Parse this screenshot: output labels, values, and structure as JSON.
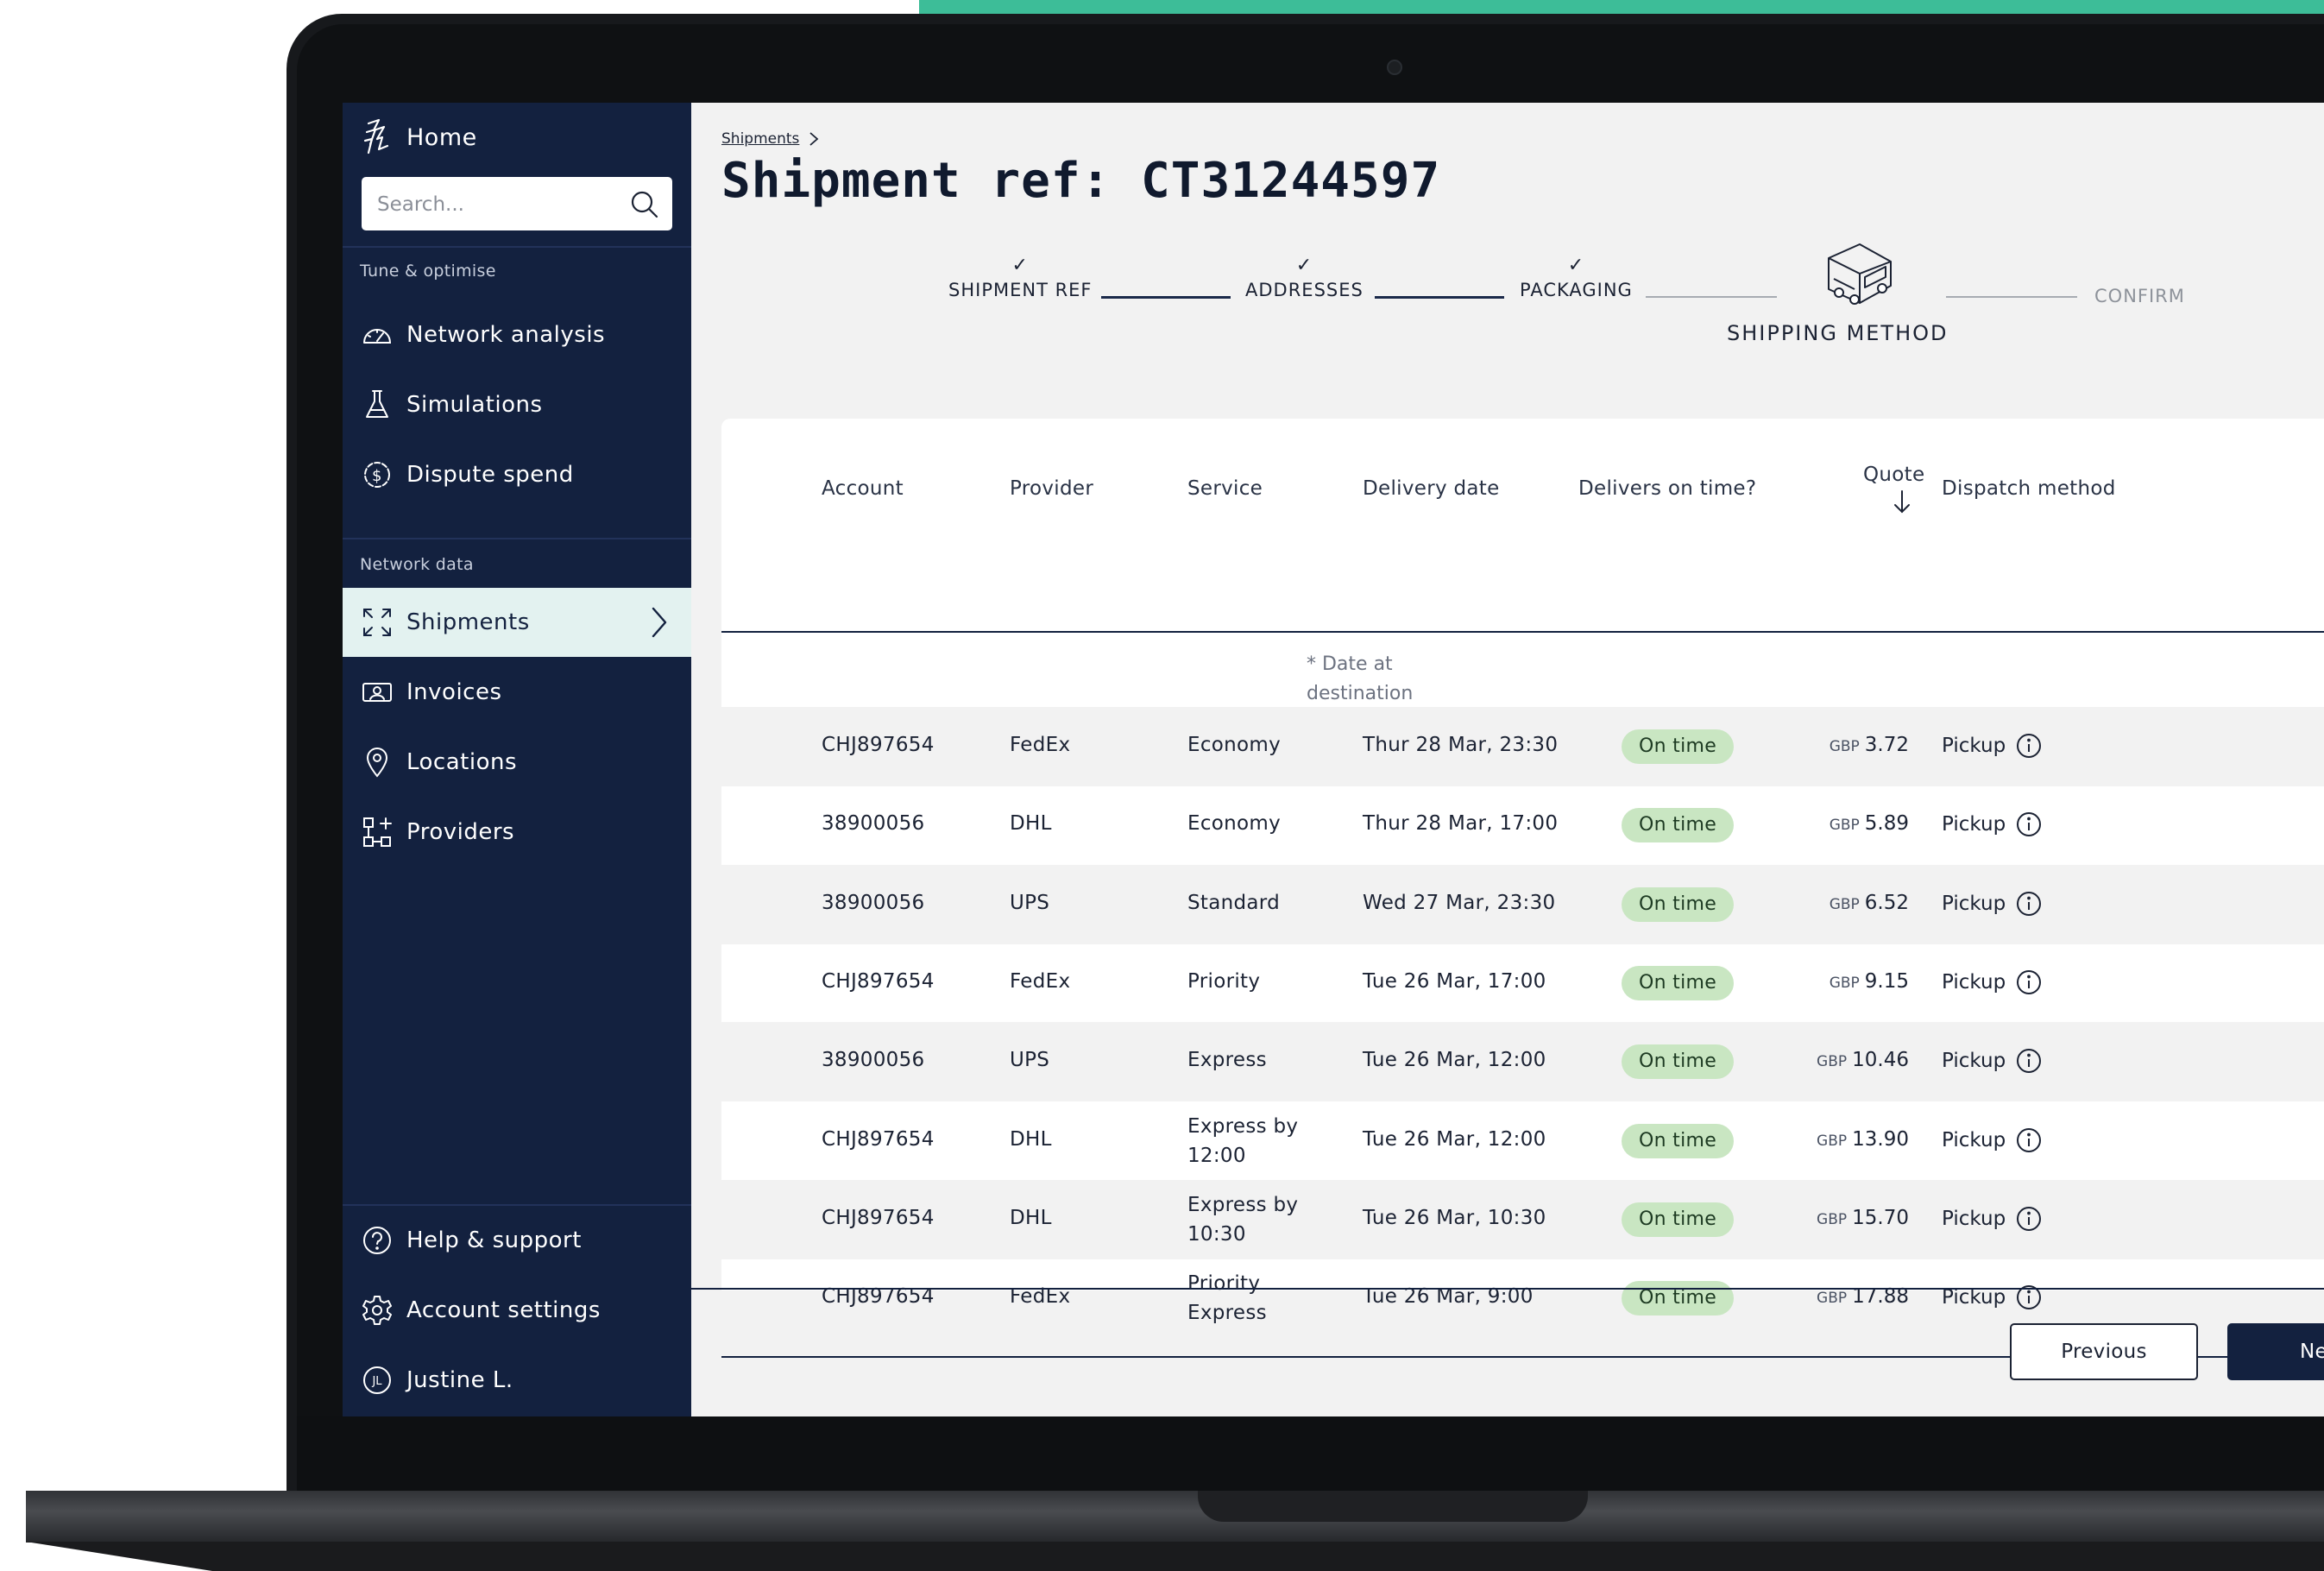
{
  "sidebar": {
    "home_label": "Home",
    "search_placeholder": "Search...",
    "section_tune": "Tune & optimise",
    "section_network": "Network data",
    "items_tune": [
      {
        "label": "Network analysis",
        "icon": "gauge-icon"
      },
      {
        "label": "Simulations",
        "icon": "flask-icon"
      },
      {
        "label": "Dispute spend",
        "icon": "dollar-shield-icon"
      }
    ],
    "items_network": [
      {
        "label": "Shipments",
        "icon": "expand-icon",
        "active": true
      },
      {
        "label": "Invoices",
        "icon": "invoice-icon"
      },
      {
        "label": "Locations",
        "icon": "location-pin-icon"
      },
      {
        "label": "Providers",
        "icon": "providers-icon"
      }
    ],
    "bottom": {
      "help": "Help & support",
      "settings": "Account settings",
      "user_name": "Justine L.",
      "user_initials": "JL"
    }
  },
  "breadcrumb": {
    "parent": "Shipments"
  },
  "page": {
    "title": "Shipment ref: CT31244597"
  },
  "stepper": {
    "steps": [
      "SHIPMENT REF",
      "ADDRESSES",
      "PACKAGING",
      "SHIPPING METHOD",
      "CONFIRM"
    ],
    "completed_marker": "✓",
    "current_index": 3
  },
  "table": {
    "headers": {
      "account": "Account",
      "provider": "Provider",
      "service": "Service",
      "delivery_date": "Delivery date",
      "on_time": "Delivers on time?",
      "quote": "Quote",
      "dispatch": "Dispatch method"
    },
    "note_line1": "* Date at",
    "note_line2": "destination",
    "currency": "GBP",
    "rows": [
      {
        "account": "CHJ897654",
        "provider": "FedEx",
        "service1": "Economy",
        "service2": "",
        "date": "Thur 28 Mar, 23:30",
        "status": "On time",
        "quote": "3.72",
        "dispatch": "Pickup"
      },
      {
        "account": "38900056",
        "provider": "DHL",
        "service1": "Economy",
        "service2": "",
        "date": "Thur 28 Mar, 17:00",
        "status": "On time",
        "quote": "5.89",
        "dispatch": "Pickup"
      },
      {
        "account": "38900056",
        "provider": "UPS",
        "service1": "Standard",
        "service2": "",
        "date": "Wed 27 Mar, 23:30",
        "status": "On time",
        "quote": "6.52",
        "dispatch": "Pickup"
      },
      {
        "account": "CHJ897654",
        "provider": "FedEx",
        "service1": "Priority",
        "service2": "",
        "date": "Tue 26 Mar, 17:00",
        "status": "On time",
        "quote": "9.15",
        "dispatch": "Pickup"
      },
      {
        "account": "38900056",
        "provider": "UPS",
        "service1": "Express",
        "service2": "",
        "date": "Tue 26 Mar, 12:00",
        "status": "On time",
        "quote": "10.46",
        "dispatch": "Pickup"
      },
      {
        "account": "CHJ897654",
        "provider": "DHL",
        "service1": "Express by",
        "service2": "12:00",
        "date": "Tue 26 Mar, 12:00",
        "status": "On time",
        "quote": "13.90",
        "dispatch": "Pickup"
      },
      {
        "account": "CHJ897654",
        "provider": "DHL",
        "service1": "Express by",
        "service2": "10:30",
        "date": "Tue 26 Mar, 10:30",
        "status": "On time",
        "quote": "15.70",
        "dispatch": "Pickup"
      },
      {
        "account": "CHJ897654",
        "provider": "FedEx",
        "service1": "Priority",
        "service2": "Express",
        "date": "Tue 26 Mar, 9:00",
        "status": "On time",
        "quote": "17.88",
        "dispatch": "Pickup"
      }
    ]
  },
  "footer": {
    "previous": "Previous",
    "next": "Nex"
  },
  "colors": {
    "accent": "#3dbd98",
    "sidebar_bg": "#13213f",
    "active_bg": "#e3f2f0",
    "pill_bg": "#c9e6c2"
  }
}
